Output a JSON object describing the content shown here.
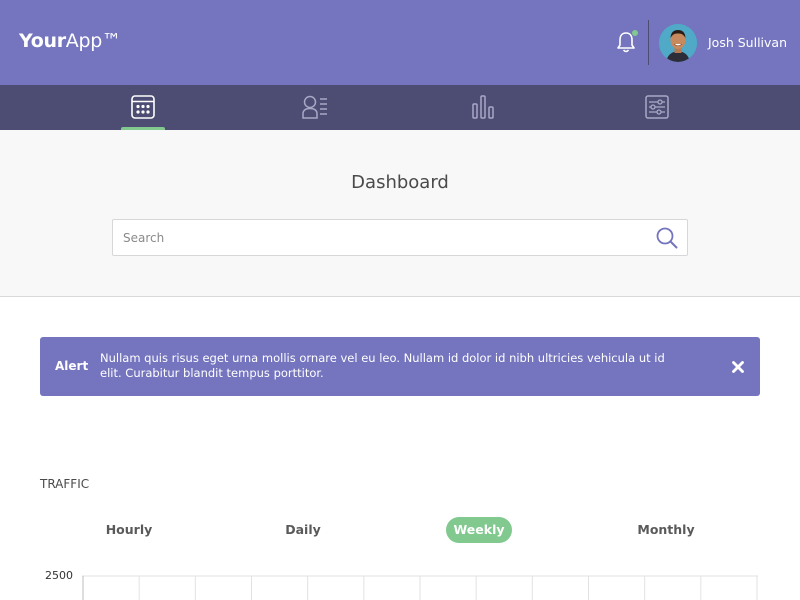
{
  "header": {
    "logo_bold": "Your",
    "logo_rest": "App™",
    "user_name": "Josh Sullivan",
    "notification_indicator": true,
    "colors": {
      "header_bg": "#7474bf",
      "nav_bg": "#4d4c72",
      "accent": "#81c98f"
    }
  },
  "nav": {
    "items": [
      {
        "icon": "calendar-icon",
        "active": true
      },
      {
        "icon": "members-icon",
        "active": false
      },
      {
        "icon": "bar-chart-icon",
        "active": false
      },
      {
        "icon": "settings-sliders-icon",
        "active": false
      }
    ]
  },
  "dashboard": {
    "title": "Dashboard",
    "search_placeholder": "Search"
  },
  "alert": {
    "label": "Alert",
    "message": "Nullam quis risus eget urna mollis ornare vel eu leo. Nullam id dolor id nibh ultricies vehicula ut id elit. Curabitur blandit tempus porttitor."
  },
  "traffic": {
    "title": "TRAFFIC",
    "tabs": [
      {
        "label": "Hourly",
        "active": false
      },
      {
        "label": "Daily",
        "active": false
      },
      {
        "label": "Weekly",
        "active": true
      },
      {
        "label": "Monthly",
        "active": false
      }
    ],
    "y_top_label": "2500"
  }
}
